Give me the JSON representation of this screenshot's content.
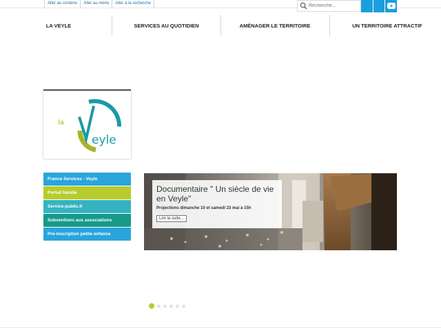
{
  "skip_links": [
    "Aller au contenu",
    "Aller au menu",
    "Aller à la recherche"
  ],
  "search": {
    "placeholder": "Recherche..."
  },
  "nav": [
    "LA VEYLE",
    "SERVICES AU QUOTIDIEN",
    "AMÉNAGER LE TERRITOIRE",
    "UN TERRITOIRE ATTRACTIF"
  ],
  "logo": {
    "text_la": "la",
    "text_veyle": "Veyle"
  },
  "quick_links": [
    {
      "label": "France Services - Veyle",
      "color": "#2aa5dc"
    },
    {
      "label": "Portail famille",
      "color": "#b7cc2c"
    },
    {
      "label": "Service-public.fr",
      "color": "#35b3c0"
    },
    {
      "label": "Subventions aux associations",
      "color": "#169a8a"
    },
    {
      "label": "Pré-inscription petite enfance",
      "color": "#2aa5dc"
    }
  ],
  "slide": {
    "title": "Documentaire \" Un siècle de vie en Veyle\"",
    "subtitle": "Projections dimanche 10 et samedi 23 mai à 15h",
    "read_more": "Lire la suite..."
  },
  "slider_dots": {
    "count": 6,
    "active": 1
  },
  "colors": {
    "accent_blue": "#1a9fdc",
    "logo_teal": "#1a9aa6",
    "logo_green": "#a7b52a"
  }
}
